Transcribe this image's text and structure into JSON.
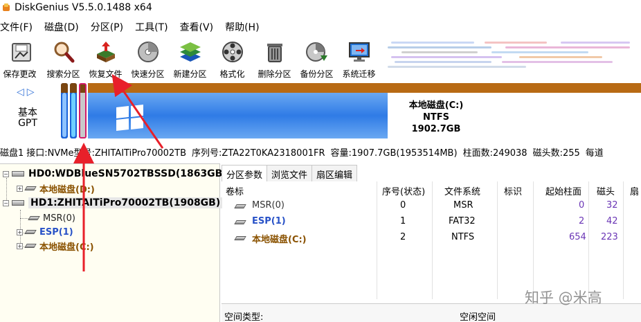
{
  "window": {
    "title": "DiskGenius V5.5.0.1488 x64"
  },
  "menu": [
    "文件(F)",
    "磁盘(D)",
    "分区(P)",
    "工具(T)",
    "查看(V)",
    "帮助(H)"
  ],
  "toolbar": [
    {
      "label": "保存更改",
      "icon": "save-icon"
    },
    {
      "label": "搜索分区",
      "icon": "magnifier-icon"
    },
    {
      "label": "恢复文件",
      "icon": "restore-box-icon"
    },
    {
      "label": "快速分区",
      "icon": "disc-icon"
    },
    {
      "label": "新建分区",
      "icon": "layers-icon"
    },
    {
      "label": "格式化",
      "icon": "format-wheel-icon"
    },
    {
      "label": "删除分区",
      "icon": "trash-icon"
    },
    {
      "label": "备份分区",
      "icon": "backup-disc-icon"
    },
    {
      "label": "系统迁移",
      "icon": "monitor-migrate-icon"
    }
  ],
  "disk": {
    "label_line1": "基本",
    "label_line2": "GPT",
    "nav": "◁▷",
    "c_name": "本地磁盘(C:)",
    "c_fs": "NTFS",
    "c_size": "1902.7GB"
  },
  "info": {
    "disk": "磁盘1",
    "iface": "接口:NVMe",
    "model": "型号:ZHITAITiPro70002TB",
    "serial": "序列号:ZTA22T0KA2318001FR",
    "capacity": "容量:1907.7GB(1953514MB)",
    "cylinders": "柱面数:249038",
    "heads": "磁头数:255",
    "spt": "每道"
  },
  "tree": {
    "hd0": "HD0:WDBlueSN5702TBSSD(1863GB)",
    "hd0_d": "本地磁盘(D:)",
    "hd1": "HD1:ZHITAITiPro70002TB(1908GB)",
    "hd1_msr": "MSR(0)",
    "hd1_esp": "ESP(1)",
    "hd1_c": "本地磁盘(C:)"
  },
  "tabs": [
    "分区参数",
    "浏览文件",
    "扇区编辑"
  ],
  "columns": [
    "卷标",
    "序号(状态)",
    "文件系统",
    "标识",
    "起始柱面",
    "磁头",
    "扇"
  ],
  "rows": [
    {
      "label": "MSR(0)",
      "seq": "0",
      "fs": "MSR",
      "cyl": "0",
      "head": "32"
    },
    {
      "label": "ESP(1)",
      "seq": "1",
      "fs": "FAT32",
      "cyl": "2",
      "head": "42"
    },
    {
      "label": "本地磁盘(C:)",
      "seq": "2",
      "fs": "NTFS",
      "cyl": "654",
      "head": "223"
    }
  ],
  "bottom": {
    "space_type": "空间类型:",
    "free_space": "空闲空间"
  },
  "watermark": "知乎 @米高",
  "colors": {
    "arrow": "#e8202a",
    "partition_blue": "#1a63d8",
    "partition_brown": "#b86a14"
  }
}
